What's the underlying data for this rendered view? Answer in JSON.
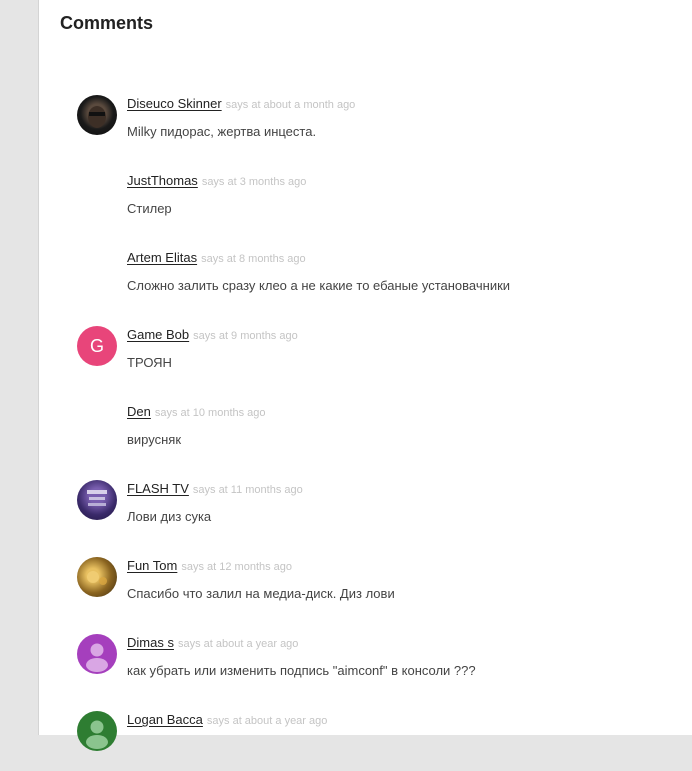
{
  "section": {
    "title": "Comments"
  },
  "comments": [
    {
      "author": "Diseuco Skinner",
      "meta": "says at about a month ago",
      "text": "Milky пидорас, жертва инцеста.",
      "avatar": "photo-icon"
    },
    {
      "author": "JustThomas",
      "meta": "says at 3 months ago",
      "text": "Стилер",
      "avatar": ""
    },
    {
      "author": "Artem Elitas",
      "meta": "says at 8 months ago",
      "text": "Сложно залить сразу клео а не какие то ебаные установачники",
      "avatar": ""
    },
    {
      "author": "Game Bob",
      "meta": "says at 9 months ago",
      "text": "ТРОЯН",
      "avatar": "letter-avatar-icon",
      "avatar_letter": "G",
      "avatar_color": "#e8457a"
    },
    {
      "author": "Den",
      "meta": "says at 10 months ago",
      "text": "вирусняк",
      "avatar": ""
    },
    {
      "author": "FLASH TV",
      "meta": "says at 11 months ago",
      "text": "Лови диз сука",
      "avatar": "photo-icon"
    },
    {
      "author": "Fun Tom",
      "meta": "says at 12 months ago",
      "text": "Спасибо что залил на медиа-диск. Диз лови",
      "avatar": "photo-icon"
    },
    {
      "author": "Dimas s",
      "meta": "says at about a year ago",
      "text": "как убрать или изменить подпись \"aimconf\" в консоли ???",
      "avatar": "default-user-icon",
      "avatar_color": "#a53fbd"
    },
    {
      "author": "Logan Bacca",
      "meta": "says at about a year ago",
      "text": "",
      "avatar": "default-user-icon",
      "avatar_color": "#2e7d32"
    }
  ],
  "colors": {
    "author": "#222222",
    "meta": "#c4c4c4",
    "text": "#444444",
    "page_bg": "#e5e5e5"
  }
}
